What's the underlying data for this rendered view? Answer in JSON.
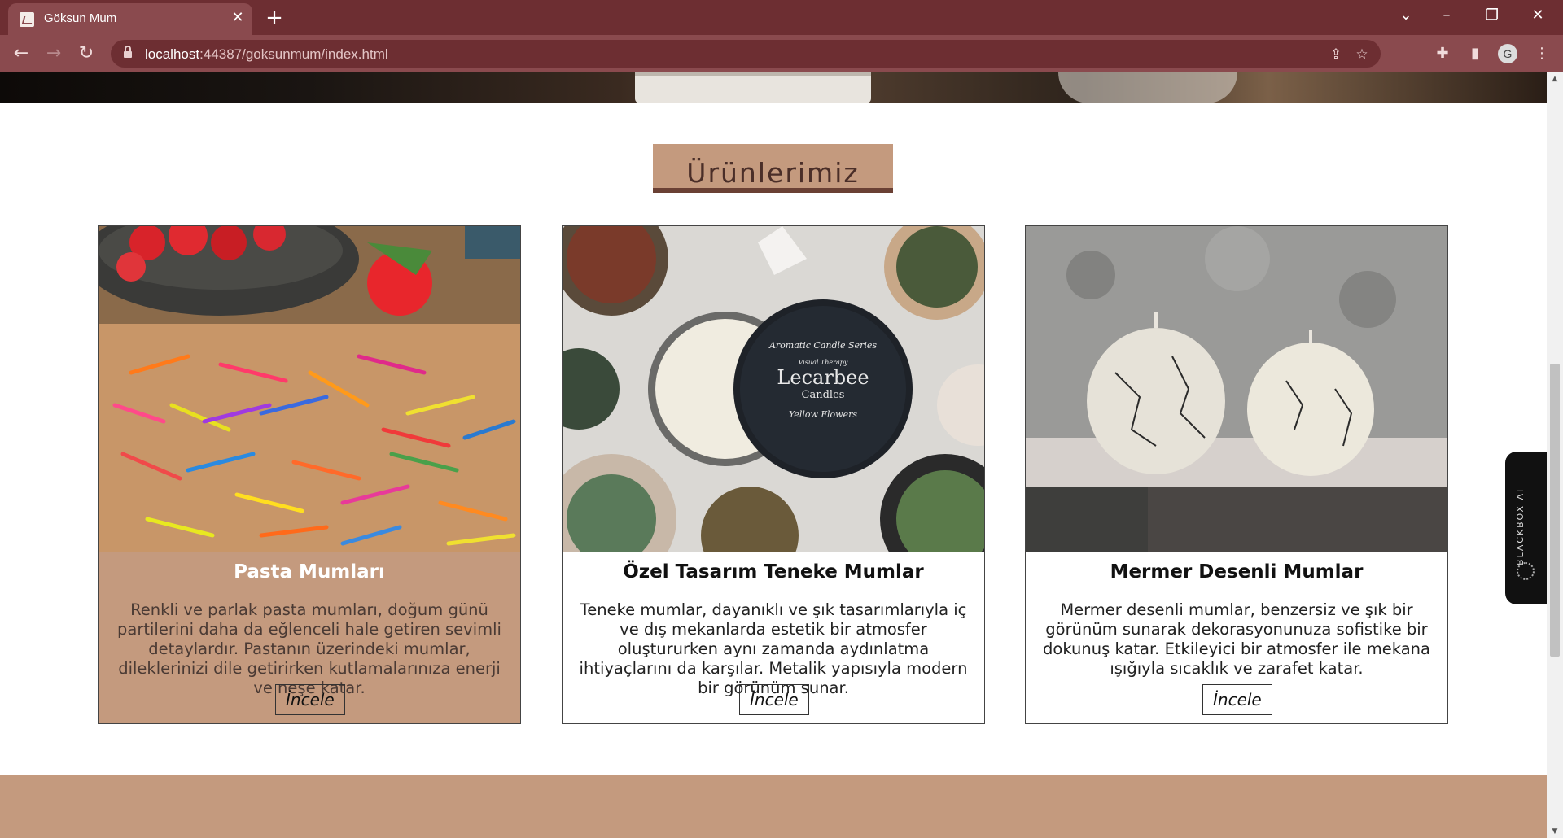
{
  "browser": {
    "tab_title": "Göksun Mum",
    "url_host": "localhost",
    "url_rest": ":44387/goksunmum/index.html",
    "profile_initial": "G"
  },
  "section": {
    "title": "Ürünlerimiz"
  },
  "products": [
    {
      "title": "Pasta Mumları",
      "description": "Renkli ve parlak pasta mumları, doğum günü partilerini daha da eğlenceli hale getiren sevimli detaylardır. Pastanın üzerindeki mumlar, dileklerinizi dile getirirken kutlamalarınıza enerji ve neşe katar.",
      "button": "İncele"
    },
    {
      "title": "Özel Tasarım Teneke Mumlar",
      "description": "Teneke mumlar, dayanıklı ve şık tasarımlarıyla iç ve dış mekanlarda estetik bir atmosfer oluştururken aynı zamanda aydınlatma ihtiyaçlarını da karşılar. Metalik yapısıyla modern bir görünüm sunar.",
      "button": "İncele"
    },
    {
      "title": "Mermer Desenli Mumlar",
      "description": "Mermer desenli mumlar, benzersiz ve şık bir görünüm sunarak dekorasyonunuza sofistike bir dokunuş katar. Etkileyici bir atmosfer ile mekana ışığıyla sıcaklık ve zarafet katar.",
      "button": "İncele"
    }
  ],
  "tin_label": {
    "line1": "Aromatic Candle Series",
    "brand": "Lecarbee",
    "sub": "Candles",
    "line2": "Yellow Flowers",
    "small": "Visual Therapy"
  },
  "widget": {
    "label": "BLACKBOX AI"
  },
  "colors": {
    "accent": "#c49a7e",
    "accent_dark": "#6a4034",
    "chrome": "#6d2e32"
  }
}
